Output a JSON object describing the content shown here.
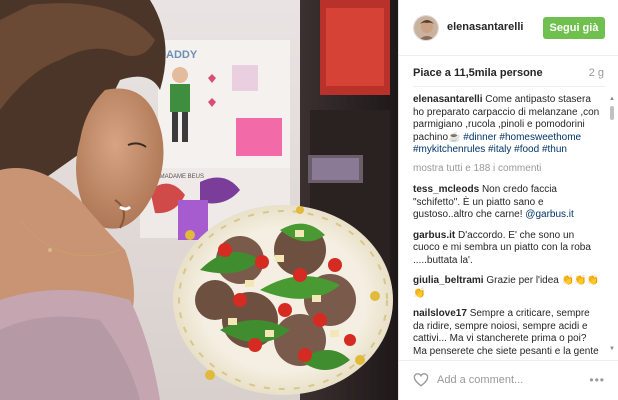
{
  "post": {
    "username": "elenasantarelli",
    "follow_label": "Segui già",
    "likes": "Piace a 11,5mila persone",
    "age": "2 g",
    "caption": {
      "user": "elenasantarelli",
      "text": "Come antipasto stasera ho preparato carpaccio di melanzane ,con parmigiano ,rucola ,pinoli e pomodorini pachino☕ ",
      "tags": "#dinner #homesweethome #mykitchenrules #italy #food #thun"
    },
    "load_more": "mostra tutti e 188 i commenti",
    "comments": [
      {
        "user": "tess_mcleods",
        "text": "Non credo faccia \"schifetto\". È un piatto sano e gustoso..altro che carne! ",
        "mention": "@garbus.it"
      },
      {
        "user": "garbus.it",
        "text": "D'accordo. E' che sono un cuoco e mi sembra un piatto con la roba .....buttata la'.",
        "mention": ""
      },
      {
        "user": "giulia_beltrami",
        "text": "Grazie per l'idea 👏👏👏👏",
        "mention": ""
      },
      {
        "user": "nailslove17",
        "text": "Sempre a criticare, sempre da ridire, sempre noiosi, sempre acidi e cattivi... Ma vi stancherete prima o poi? Ma penserete che siete pesanti e la gente per questione di educazione non vi risponde ma è 'Ma usa..' io vi direi",
        "mention": ""
      }
    ],
    "add_comment_placeholder": "Add a comment...",
    "more_options": "•••"
  },
  "photo": {
    "drawing_caption": "ADDY",
    "fridge_note": "BE MADAME BEUS"
  },
  "icons": {
    "like": "heart-outline-icon",
    "more": "more-dots-icon"
  },
  "colors": {
    "follow_button": "#70c050",
    "hashtag": "#003569",
    "muted": "#999999"
  }
}
